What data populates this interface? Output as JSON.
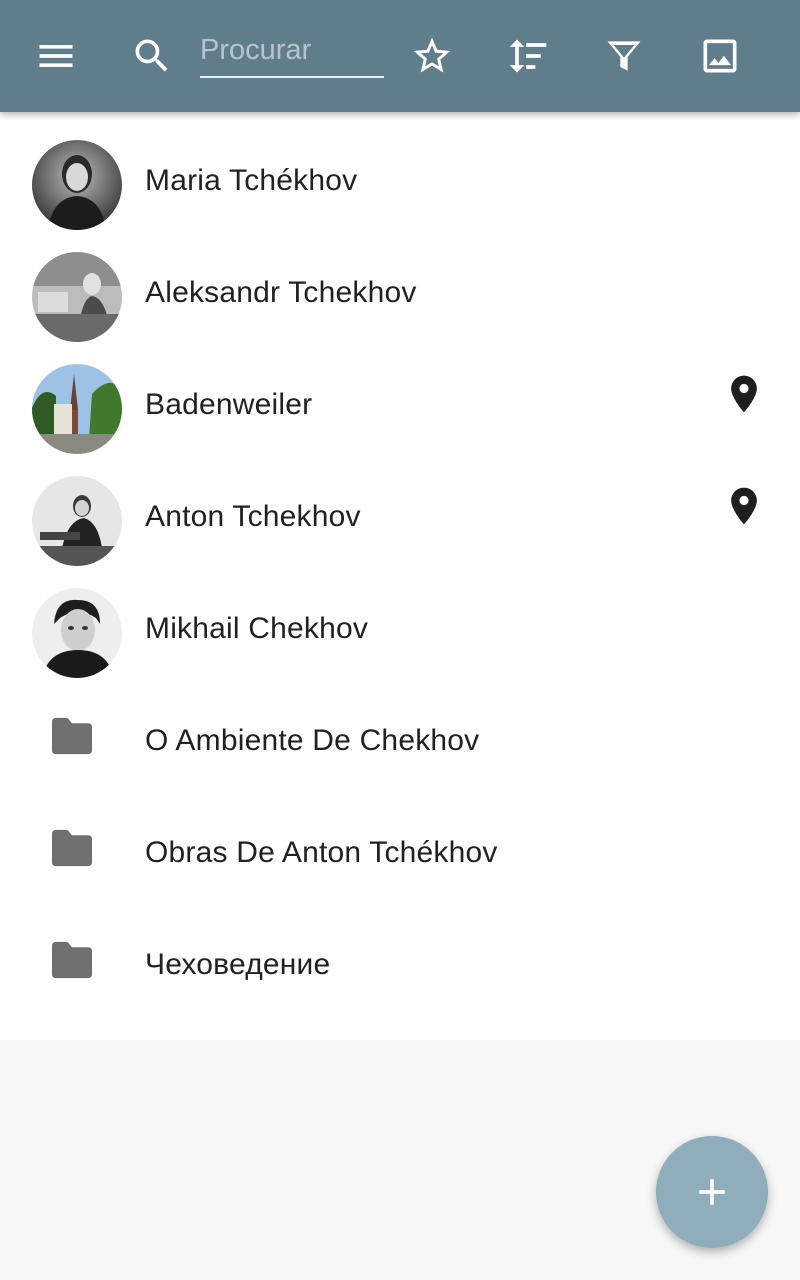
{
  "toolbar": {
    "menu_icon": "menu-icon",
    "search_icon": "search-icon",
    "search_placeholder": "Procurar",
    "search_value": "",
    "star_icon": "star-outline-icon",
    "sort_icon": "sort-icon",
    "filter_icon": "filter-icon",
    "image_icon": "image-icon",
    "background_color": "#607d8b"
  },
  "items": [
    {
      "label": "Maria Tchékhov",
      "type": "person",
      "has_location": false
    },
    {
      "label": "Aleksandr Tchekhov",
      "type": "person",
      "has_location": false
    },
    {
      "label": "Badenweiler",
      "type": "place",
      "has_location": true
    },
    {
      "label": "Anton Tchekhov",
      "type": "person",
      "has_location": true
    },
    {
      "label": "Mikhail Chekhov",
      "type": "person",
      "has_location": false
    },
    {
      "label": "O Ambiente De Chekhov",
      "type": "folder",
      "has_location": false
    },
    {
      "label": "Obras De Anton Tchékhov",
      "type": "folder",
      "has_location": false
    },
    {
      "label": "Чеховедение",
      "type": "folder",
      "has_location": false
    }
  ],
  "fab": {
    "icon": "plus-icon",
    "color": "#90adbc"
  }
}
